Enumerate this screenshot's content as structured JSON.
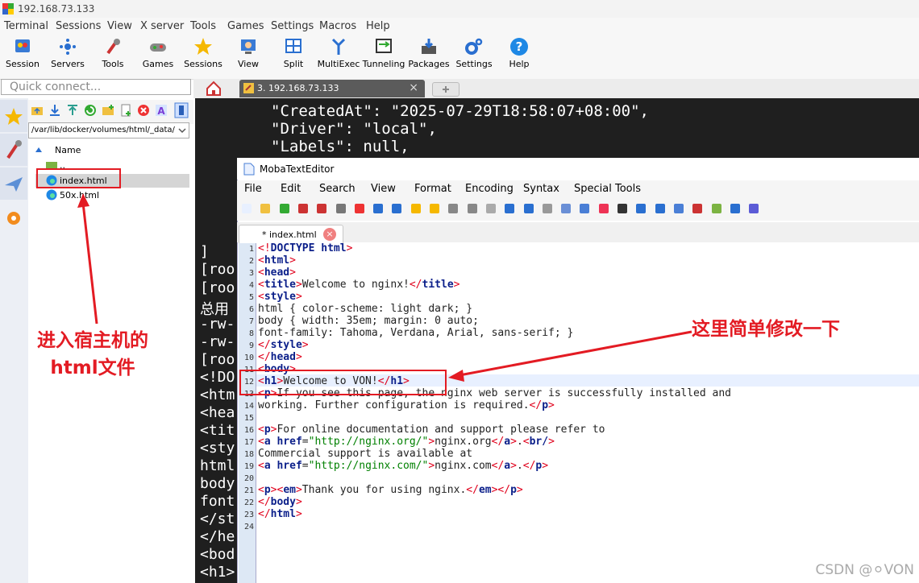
{
  "window": {
    "title": "192.168.73.133"
  },
  "menu": [
    "Terminal",
    "Sessions",
    "View",
    "X server",
    "Tools",
    "Games",
    "Settings",
    "Macros",
    "Help"
  ],
  "toolbar": [
    "Session",
    "Servers",
    "Tools",
    "Games",
    "Sessions",
    "View",
    "Split",
    "MultiExec",
    "Tunneling",
    "Packages",
    "Settings",
    "Help"
  ],
  "quick_connect": {
    "placeholder": "Quick connect..."
  },
  "tabs": {
    "session_label": "3. 192.168.73.133",
    "close": "×"
  },
  "sftp": {
    "path": "/var/lib/docker/volumes/html/_data/",
    "column_name": "Name",
    "parent": "..",
    "files": [
      "index.html",
      "50x.html"
    ]
  },
  "terminal": {
    "lines_top": [
      "\"CreatedAt\": \"2025-07-29T18:58:07+08:00\",",
      "\"Driver\": \"local\",",
      "\"Labels\": null,"
    ],
    "lines_left": [
      "]",
      "[roo",
      "[roo",
      "总用",
      "-rw-",
      "-rw-",
      "[roo",
      "<!DO",
      "<htm",
      "<hea",
      "<tit",
      "<sty",
      "html",
      "body",
      "font",
      "</st",
      "</he",
      "<bod",
      "<h1>"
    ]
  },
  "editor": {
    "title": "MobaTextEditor",
    "menu": [
      "File",
      "Edit",
      "Search",
      "View",
      "Format",
      "Encoding",
      "Syntax",
      "Special Tools"
    ],
    "tab_label": "* index.html",
    "line_numbers": [
      "1",
      "2",
      "3",
      "4",
      "5",
      "6",
      "7",
      "8",
      "9",
      "10",
      "11",
      "12",
      "13",
      "14",
      "15",
      "16",
      "17",
      "18",
      "19",
      "20",
      "21",
      "22",
      "23",
      "24"
    ],
    "code": {
      "l1": "DOCTYPE html",
      "l2": "html",
      "l3": "head",
      "l4_tag": "title",
      "l4_text": "Welcome to nginx!",
      "l5": "style",
      "l6": "html { color-scheme: light dark; }",
      "l7": "body { width: 35em; margin: 0 auto;",
      "l8": "font-family: Tahoma, Verdana, Arial, sans-serif; }",
      "l9": "style",
      "l10": "head",
      "l11": "body",
      "l12_tag": "h1",
      "l12_text": "Welcome to VON!",
      "l13_tag": "p",
      "l13_text": "If you see this page, the nginx web server is successfully installed and",
      "l14": "working. Further configuration is required.",
      "l16_text": "For online documentation and support please refer to",
      "l17_href": "\"http://nginx.org/\"",
      "l17_text": "nginx.org",
      "l17_tail": ".",
      "l17_br": "br/",
      "l18": "Commercial support is available at",
      "l19_href": "\"http://nginx.com/\"",
      "l19_text": "nginx.com",
      "l19_tail": ".",
      "l21_text": "Thank you for using nginx.",
      "l22": "body",
      "l23": "html",
      "a_tag": "a",
      "href_attr": "href",
      "em_tag": "em"
    }
  },
  "annotations": {
    "left_note": "进入宿主机的\nhtml文件",
    "right_note": "这里简单修改一下"
  },
  "watermark": "CSDN @⚪VON",
  "colors": {
    "annotation_red": "#e31b23",
    "terminal_bg": "#1f1f1f",
    "tag_red": "#e0001b",
    "keyword_blue": "#0b1f8a",
    "string_green": "#008000"
  }
}
